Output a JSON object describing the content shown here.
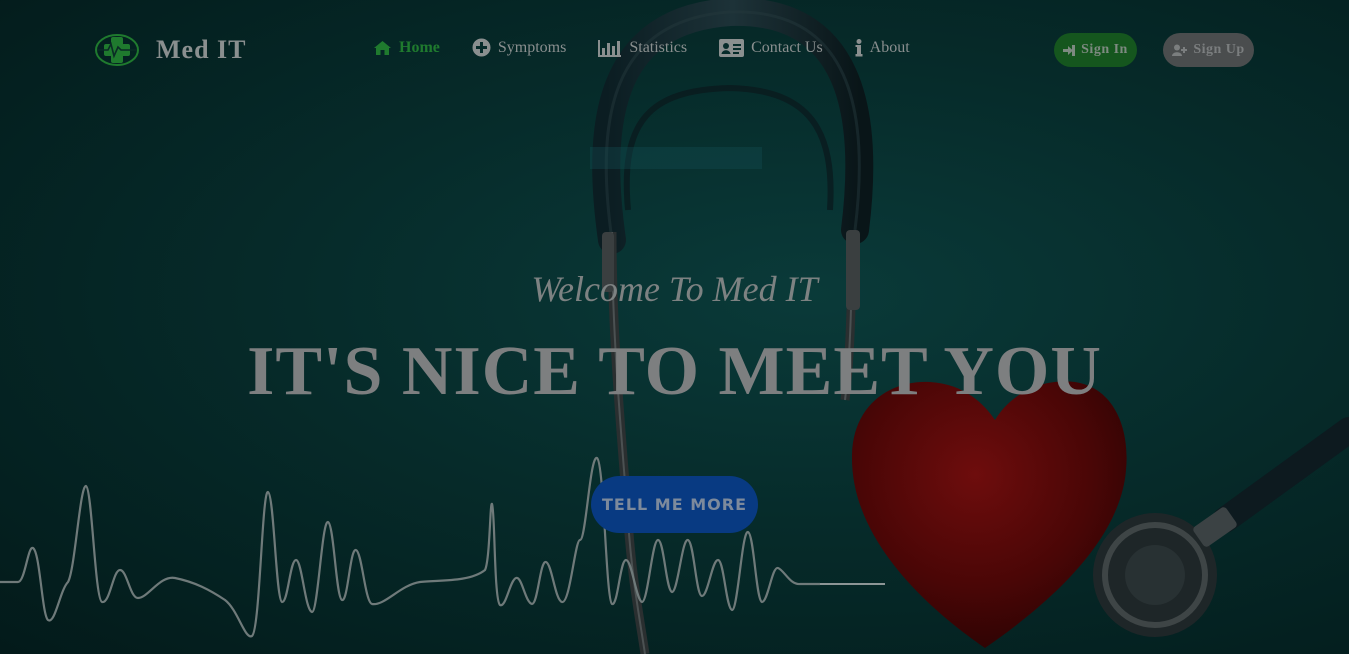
{
  "brand": {
    "title": "Med IT",
    "logo_icon": "medical-cross-heartbeat-icon",
    "accent_color": "#1f7a2e"
  },
  "nav": {
    "items": [
      {
        "label": "Home",
        "icon": "home-icon",
        "active": true
      },
      {
        "label": "Symptoms",
        "icon": "plus-circle-icon",
        "active": false
      },
      {
        "label": "Statistics",
        "icon": "bar-chart-icon",
        "active": false
      },
      {
        "label": "Contact Us",
        "icon": "address-card-icon",
        "active": false
      },
      {
        "label": "About",
        "icon": "info-icon",
        "active": false
      }
    ]
  },
  "auth": {
    "signin_label": "Sign In",
    "signin_icon": "sign-in-icon",
    "signup_label": "Sign Up",
    "signup_icon": "user-plus-icon"
  },
  "hero": {
    "subtitle": "Welcome To Med IT",
    "title": "IT'S NICE TO MEET YOU",
    "cta_label": "TELL ME MORE",
    "cta_color": "#083a82"
  }
}
